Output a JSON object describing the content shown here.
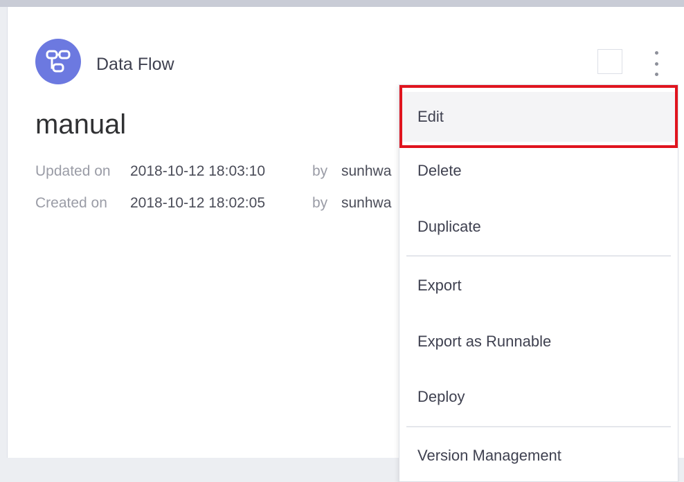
{
  "card": {
    "type_icon": "data-flow-icon",
    "type_label": "Data Flow",
    "title": "manual",
    "updated": {
      "label": "Updated on",
      "value": "2018-10-12 18:03:10",
      "by_label": "by",
      "user": "sunhwa"
    },
    "created": {
      "label": "Created on",
      "value": "2018-10-12 18:02:05",
      "by_label": "by",
      "user": "sunhwa"
    }
  },
  "menu": {
    "items": [
      {
        "label": "Edit"
      },
      {
        "label": "Delete"
      },
      {
        "label": "Duplicate"
      },
      {
        "label": "Export"
      },
      {
        "label": "Export as Runnable"
      },
      {
        "label": "Deploy"
      },
      {
        "label": "Version Management"
      }
    ]
  },
  "colors": {
    "icon_bg": "#6c79e0",
    "highlight_outline": "#e0141e",
    "background": "#eceef2"
  }
}
